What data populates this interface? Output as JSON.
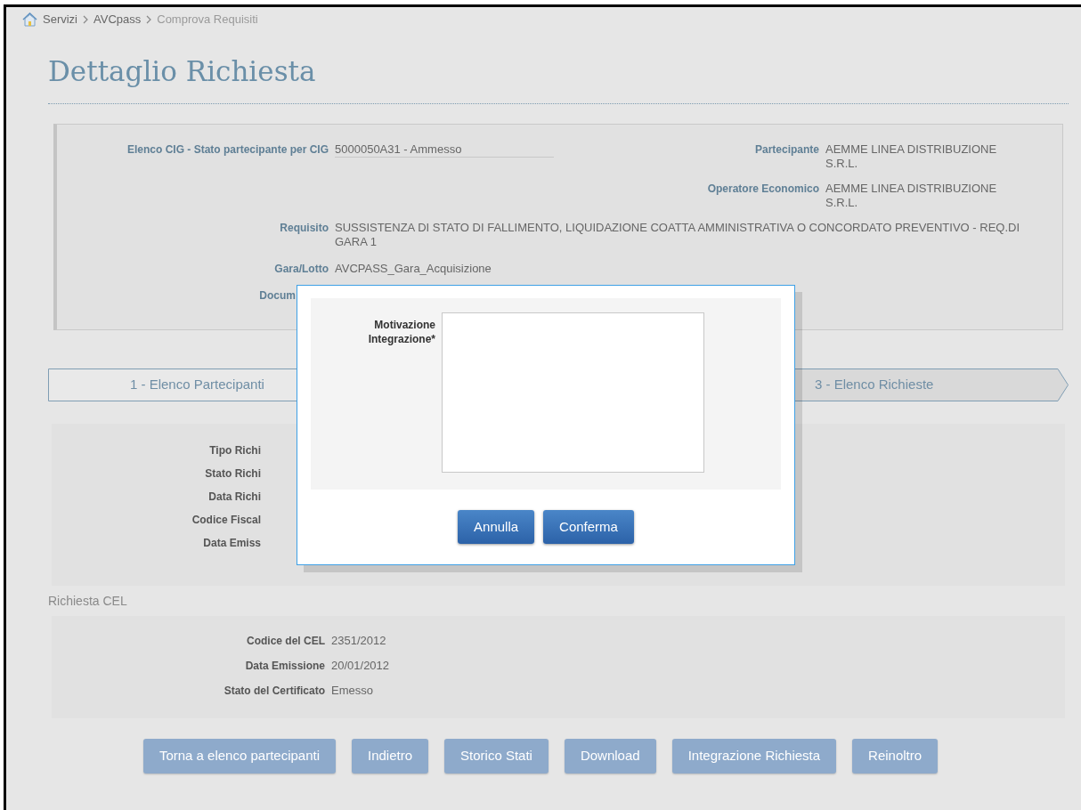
{
  "breadcrumb": [
    {
      "label": "Servizi",
      "current": false
    },
    {
      "label": "AVCpass",
      "current": false
    },
    {
      "label": "Comprova Requisiti",
      "current": true
    }
  ],
  "title": "Dettaglio Richiesta",
  "info_panel": {
    "top_left": [
      {
        "label": "Elenco CIG - Stato partecipante per CIG",
        "value": "5000050A31 - Ammesso"
      }
    ],
    "top_right": [
      {
        "label": "Partecipante",
        "value": "AEMME LINEA DISTRIBUZIONE S.R.L."
      },
      {
        "label": "Operatore Economico",
        "value": "AEMME LINEA DISTRIBUZIONE S.R.L."
      }
    ],
    "rows": [
      {
        "label": "Requisito",
        "value": "SUSSISTENZA DI STATO DI FALLIMENTO, LIQUIDAZIONE COATTA AMMINISTRATIVA O CONCORDATO PREVENTIVO - REQ.DI GARA 1"
      },
      {
        "label": "Gara/Lotto",
        "value": "AVCPASS_Gara_Acquisizione"
      },
      {
        "label": "Docum"
      }
    ]
  },
  "steps": [
    {
      "label": "1 - Elenco Partecipanti",
      "selected": false
    },
    {
      "label": "3 - Elenco Richieste",
      "selected": true
    }
  ],
  "request_panel": {
    "fields": [
      {
        "label": "Tipo Richi"
      },
      {
        "label": "Stato Richi"
      },
      {
        "label": "Data Richi"
      },
      {
        "label": "Codice Fiscal"
      },
      {
        "label": "Data Emiss"
      }
    ]
  },
  "cel_section": {
    "title": "Richiesta CEL",
    "fields": [
      {
        "label": "Codice del CEL",
        "value": "2351/2012"
      },
      {
        "label": "Data Emissione",
        "value": "20/01/2012"
      },
      {
        "label": "Stato del Certificato",
        "value": "Emesso"
      }
    ]
  },
  "buttons": [
    "Torna a elenco partecipanti",
    "Indietro",
    "Storico Stati",
    "Download",
    "Integrazione Richiesta",
    "Reinoltro"
  ],
  "modal": {
    "field": {
      "label": "Motivazione Integrazione*"
    },
    "buttons": [
      "Annulla",
      "Conferma"
    ]
  }
}
